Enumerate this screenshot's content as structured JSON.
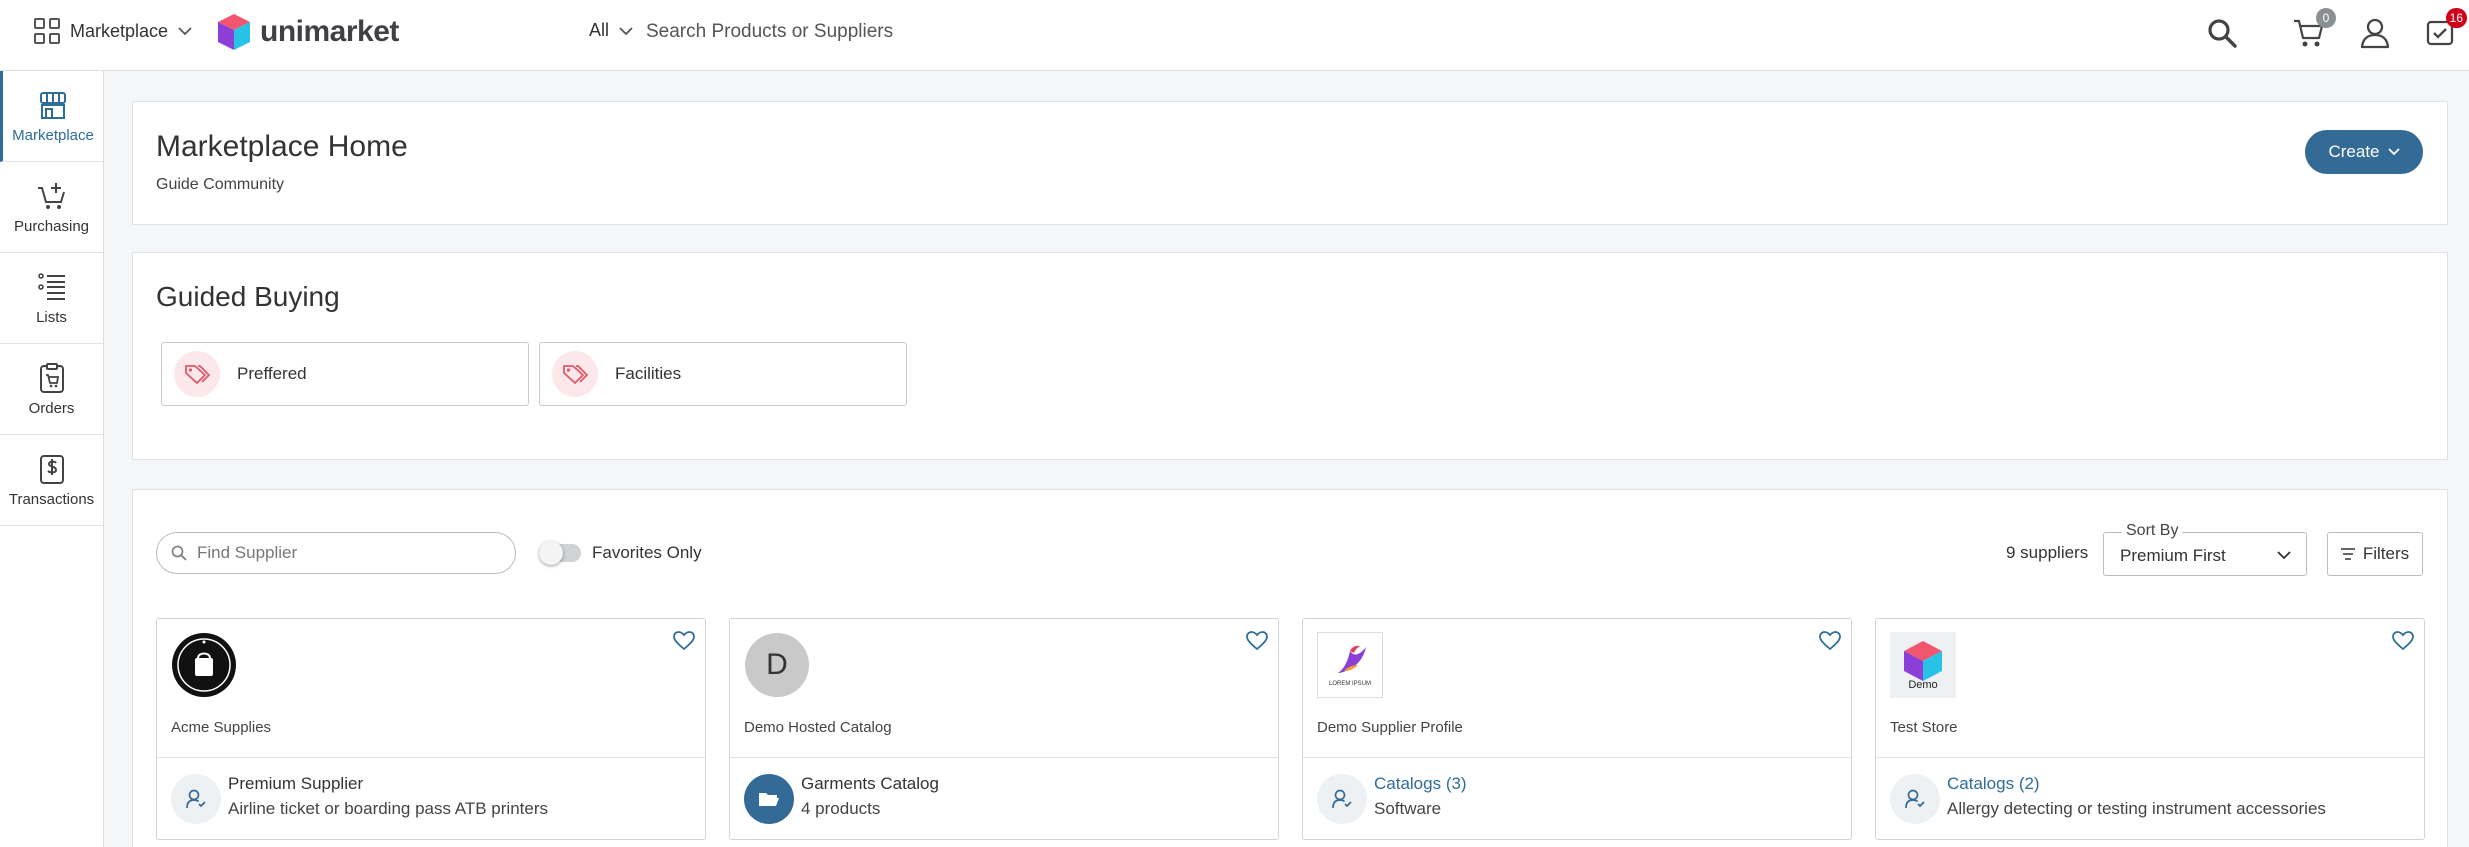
{
  "topbar": {
    "app_switcher_label": "Marketplace",
    "logo_text": "unimarket",
    "search_scope": "All",
    "search_placeholder": "Search Products or Suppliers",
    "cart_count": "0",
    "notifications_count": "16"
  },
  "leftnav": {
    "items": [
      {
        "label": "Marketplace",
        "icon": "storefront-icon",
        "active": true
      },
      {
        "label": "Purchasing",
        "icon": "cart-plus-icon"
      },
      {
        "label": "Lists",
        "icon": "list-icon"
      },
      {
        "label": "Orders",
        "icon": "order-clipboard-icon"
      },
      {
        "label": "Transactions",
        "icon": "dollar-document-icon"
      }
    ]
  },
  "hero": {
    "title": "Marketplace Home",
    "subtitle": "Guide Community",
    "create_label": "Create"
  },
  "guided_buying": {
    "title": "Guided Buying",
    "tiles": [
      {
        "label": "Preffered",
        "icon": "tag-icon"
      },
      {
        "label": "Facilities",
        "icon": "tag-icon"
      }
    ]
  },
  "suppliers": {
    "find_placeholder": "Find Supplier",
    "favorites_label": "Favorites Only",
    "favorites_on": false,
    "count_text": "9 suppliers",
    "sort_legend": "Sort By",
    "sort_value": "Premium First",
    "filters_label": "Filters",
    "cards": [
      {
        "name": "Acme Supplies",
        "logo": "acme-seal-logo",
        "foot_title": "Premium Supplier",
        "foot_sub": "Airline ticket or boarding pass ATB printers",
        "foot_icon": "user-icon",
        "link": false
      },
      {
        "name": "Demo Hosted Catalog",
        "logo_letter": "D",
        "foot_title": "Garments Catalog",
        "foot_sub": "4 products",
        "foot_icon": "folder-open-icon",
        "link": false
      },
      {
        "name": "Demo Supplier Profile",
        "logo": "bird-logo",
        "logo_caption": "LOREM IPSUM",
        "foot_title": "Catalogs (3)",
        "foot_sub": "Software",
        "foot_icon": "user-icon",
        "link": true
      },
      {
        "name": "Test Store",
        "logo": "cube-logo",
        "logo_caption": "Demo",
        "foot_title": "Catalogs (2)",
        "foot_sub": "Allergy detecting or testing instrument accessories",
        "foot_icon": "user-icon",
        "link": true
      }
    ]
  },
  "colors": {
    "brand_blue": "#336a96",
    "badge_red": "#d0021b",
    "badge_grey": "#8a8f94",
    "tag_pink": "#e0576a"
  }
}
